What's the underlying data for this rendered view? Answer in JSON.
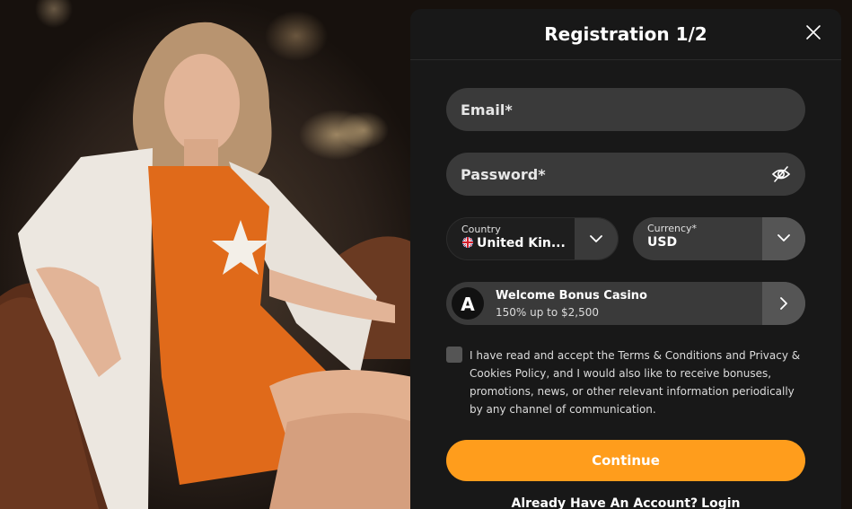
{
  "modal": {
    "title": "Registration 1/2",
    "close_icon": "close-icon"
  },
  "form": {
    "email_placeholder": "Email*",
    "password_placeholder": "Password*",
    "password_toggle_icon": "eye-off-icon",
    "country": {
      "label": "Country",
      "value": "United Kin...",
      "flag_icon": "uk-flag-icon"
    },
    "currency": {
      "label": "Currency*",
      "value": "USD"
    }
  },
  "bonus": {
    "title": "Welcome Bonus Casino",
    "subtitle": "150% up to $2,500",
    "logo_letter": "A"
  },
  "terms": {
    "text_before": "I have read and accept the ",
    "terms_link": "Terms & Conditions",
    "text_middle": " and ",
    "privacy_link": "Privacy & Cookies Policy",
    "text_after": ", and I would also like to receive bonuses, promotions, news, or other relevant information periodically by any channel of communication."
  },
  "actions": {
    "continue_label": "Continue",
    "already_account_text": "Already Have An Account?",
    "login_label": "Login"
  },
  "colors": {
    "accent": "#ff9d1c",
    "modal_bg": "#181818",
    "field_bg": "#3a3a3a",
    "dress_orange": "#e06a1a"
  }
}
